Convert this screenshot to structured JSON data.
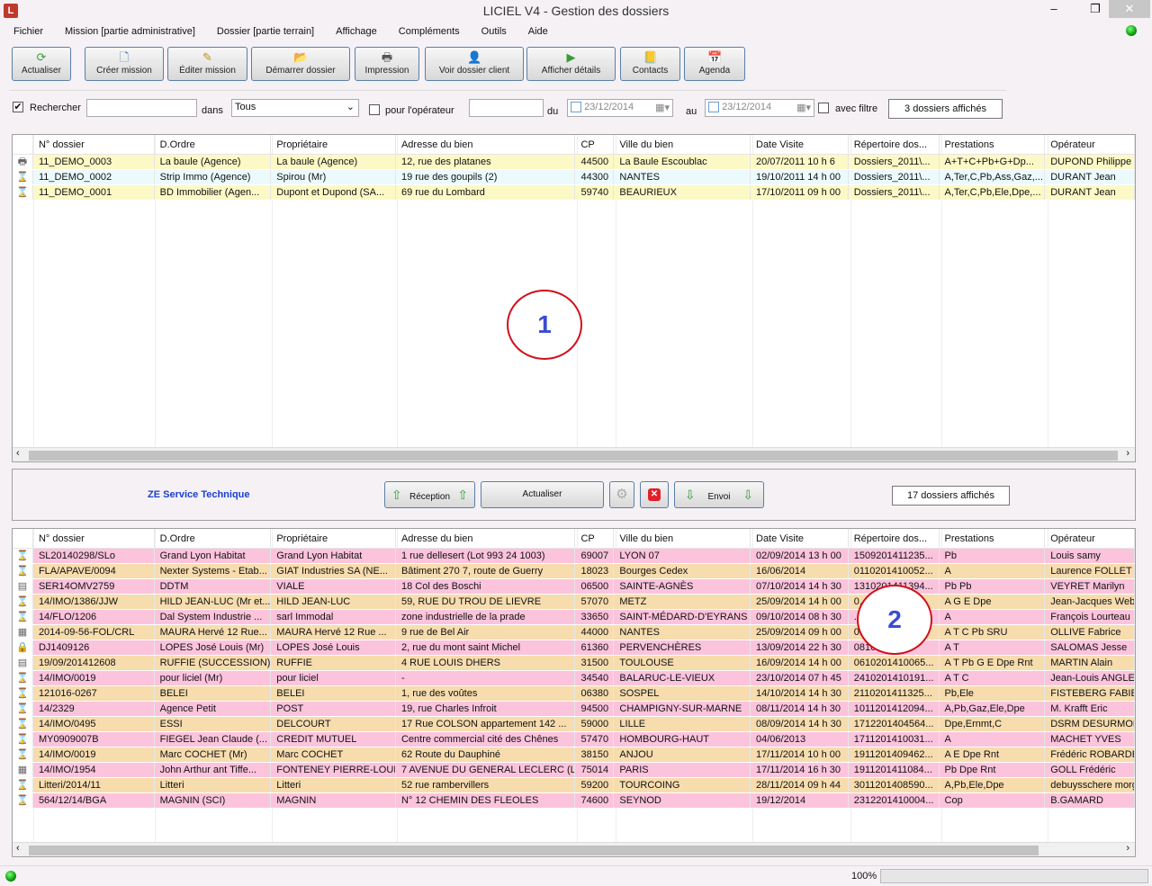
{
  "window": {
    "title": "LICIEL V4 - Gestion des dossiers",
    "app_icon": "L"
  },
  "menu": [
    "Fichier",
    "Mission [partie administrative]",
    "Dossier [partie terrain]",
    "Affichage",
    "Compléments",
    "Outils",
    "Aide"
  ],
  "toolbar": [
    {
      "label": "Actualiser",
      "icon": "refresh-icon",
      "glyph": "⟳",
      "color": "#3aa33a"
    },
    {
      "label": "Créer mission",
      "icon": "new-document-icon",
      "glyph": "🗋",
      "color": "#3a6fb0"
    },
    {
      "label": "Éditer mission",
      "icon": "edit-document-icon",
      "glyph": "✎",
      "color": "#c8901a"
    },
    {
      "label": "Démarrer dossier",
      "icon": "start-folder-icon",
      "glyph": "📂",
      "color": "#d8a020"
    },
    {
      "label": "Impression",
      "icon": "printer-icon",
      "glyph": "🖶",
      "color": "#555"
    },
    {
      "label": "Voir dossier client",
      "icon": "client-folder-icon",
      "glyph": "👤",
      "color": "#d07020"
    },
    {
      "label": "Afficher détails",
      "icon": "details-icon",
      "glyph": "▶",
      "color": "#3a9a3a"
    },
    {
      "label": "Contacts",
      "icon": "contacts-book-icon",
      "glyph": "📒",
      "color": "#6a6a30"
    },
    {
      "label": "Agenda",
      "icon": "calendar-icon",
      "glyph": "📅",
      "color": "#c02020"
    }
  ],
  "filter": {
    "search_checked": true,
    "search_label": "Rechercher",
    "search_value": "",
    "dans_label": "dans",
    "dans_value": "Tous",
    "operator_checked": false,
    "operator_label": "pour l'opérateur",
    "operator_value": "",
    "du_label": "du",
    "date_from": "23/12/2014",
    "au_label": "au",
    "date_to": "23/12/2014",
    "avec_filtre_checked": false,
    "avec_filtre_label": "avec filtre",
    "count": "3 dossiers affichés"
  },
  "columns": [
    "N° dossier",
    "D.Ordre",
    "Propriétaire",
    "Adresse du bien",
    "CP",
    "Ville du bien",
    "Date Visite",
    "Répertoire dos...",
    "Prestations",
    "Opérateur"
  ],
  "top_rows": [
    {
      "icon": "printer-add-icon",
      "cells": [
        "11_DEMO_0003",
        "La baule (Agence)",
        "La baule (Agence)",
        "12, rue des platanes",
        "44500",
        "La Baule Escoublac",
        "20/07/2011 10 h 6",
        "Dossiers_2011\\...",
        "A+T+C+Pb+G+Dp...",
        "DUPOND Philippe"
      ]
    },
    {
      "icon": "hourglass-add-icon",
      "cells": [
        "11_DEMO_0002",
        "Strip Immo (Agence)",
        "Spirou (Mr)",
        "19 rue des goupils (2)",
        "44300",
        "NANTES",
        "19/10/2011 14 h 00",
        "Dossiers_2011\\...",
        "A,Ter,C,Pb,Ass,Gaz,...",
        "DURANT Jean"
      ]
    },
    {
      "icon": "hourglass-add-icon",
      "cells": [
        "11_DEMO_0001",
        "BD Immobilier (Agen...",
        "Dupont et Dupond (SA...",
        "69 rue du Lombard",
        "59740",
        "BEAURIEUX",
        "17/10/2011 09 h 00",
        "Dossiers_2011\\...",
        "A,Ter,C,Pb,Ele,Dpe,...",
        "DURANT Jean"
      ]
    }
  ],
  "annotation1": "1",
  "annotation2": "2",
  "service": {
    "title": "ZE Service Technique",
    "reception": "Réception",
    "actualiser": "Actualiser",
    "envoi": "Envoi",
    "count": "17 dossiers affichés"
  },
  "bottom_rows": [
    {
      "icon": "hourglass-add-icon",
      "cells": [
        "SL20140298/SLo",
        "Grand Lyon Habitat",
        "Grand Lyon Habitat",
        "1 rue dellesert (Lot 993 24 1003)",
        "69007",
        "LYON 07",
        "02/09/2014 13 h 00",
        "1509201411235...",
        "Pb",
        "Louis samy"
      ]
    },
    {
      "icon": "hourglass-icon",
      "cells": [
        "FLA/APAVE/0094",
        "Nexter Systems - Etab...",
        "GIAT Industries SA (NE...",
        "Bâtiment 270 7, route de Guerry",
        "18023",
        "Bourges Cedex",
        "16/06/2014",
        "0110201410052...",
        "A",
        "Laurence FOLLET"
      ]
    },
    {
      "icon": "edit-form-icon",
      "cells": [
        "SER14OMV2759",
        "DDTM",
        "VIALE",
        "18 Col des Boschi",
        "06500",
        "SAINTE-AGNÈS",
        "07/10/2014 14 h 30",
        "1310201411394...",
        "Pb Pb",
        "VEYRET Marilyn"
      ]
    },
    {
      "icon": "hourglass-add-icon",
      "cells": [
        "14/IMO/1386/JJW",
        "HILD JEAN-LUC (Mr et...",
        "HILD JEAN-LUC",
        "59, RUE DU TROU DE LIEVRE",
        "57070",
        "METZ",
        "25/09/2014 14 h 00",
        "0...",
        "A G E Dpe",
        "Jean-Jacques Weber"
      ]
    },
    {
      "icon": "hourglass-icon",
      "cells": [
        "14/FLO/1206",
        "Dal System Industrie ...",
        "sarl Immodal",
        "zone industrielle de la prade",
        "33650",
        "SAINT-MÉDARD-D'EYRANS",
        "09/10/2014 08 h 30",
        "...",
        "A",
        "François Lourteau"
      ]
    },
    {
      "icon": "form-add-icon",
      "cells": [
        "2014-09-56-FOL/CRL",
        "MAURA Hervé 12 Rue...",
        "MAURA Hervé 12 Rue ...",
        "9 rue de Bel Air",
        "44000",
        "NANTES",
        "25/09/2014 09 h 00",
        "0...",
        "A T C Pb SRU",
        "OLLIVE Fabrice"
      ]
    },
    {
      "icon": "lock-icon",
      "cells": [
        "DJ1409126",
        "LOPES José Louis (Mr)",
        "LOPES José Louis",
        "2, rue du mont saint Michel",
        "61360",
        "PERVENCHÈRES",
        "13/09/2014 22 h 30",
        "0810...484...",
        "A T",
        "SALOMAS Jesse"
      ]
    },
    {
      "icon": "edit-form-icon",
      "cells": [
        "19/09/201412608",
        "RUFFIE (SUCCESSION)",
        "RUFFIE",
        "4 RUE LOUIS DHERS",
        "31500",
        "TOULOUSE",
        "16/09/2014 14 h 00",
        "0610201410065...",
        "A T Pb G E Dpe Rnt",
        "MARTIN Alain"
      ]
    },
    {
      "icon": "hourglass-add-icon",
      "cells": [
        "14/IMO/0019",
        "pour liciel (Mr)",
        "pour liciel",
        "-",
        "34540",
        "BALARUC-LE-VIEUX",
        "23/10/2014 07 h 45",
        "2410201410191...",
        "A T C",
        "Jean-Louis ANGLES"
      ]
    },
    {
      "icon": "hourglass-icon",
      "cells": [
        "121016-0267",
        "BELEI",
        "BELEI",
        "1, rue des voûtes",
        "06380",
        "SOSPEL",
        "14/10/2014 14 h 30",
        "2110201411325...",
        "Pb,Ele",
        "FISTEBERG FABIEN"
      ]
    },
    {
      "icon": "hourglass-icon",
      "cells": [
        "14/2329",
        "Agence Petit",
        "POST",
        "19, rue Charles Infroit",
        "94500",
        "CHAMPIGNY-SUR-MARNE",
        "08/11/2014 14 h 30",
        "1011201412094...",
        "A,Pb,Gaz,Ele,Dpe",
        "M. Krafft Eric"
      ]
    },
    {
      "icon": "hourglass-icon",
      "cells": [
        "14/IMO/0495",
        "ESSI",
        "DELCOURT",
        "17 Rue COLSON appartement 142 ...",
        "59000",
        "LILLE",
        "08/09/2014 14 h 30",
        "1712201404564...",
        "Dpe,Ernmt,C",
        "DSRM DESURMONT"
      ]
    },
    {
      "icon": "hourglass-add-icon",
      "cells": [
        "MY0909007B",
        "FIEGEL Jean Claude  (...",
        "CREDIT MUTUEL",
        "Centre commercial cité des Chênes",
        "57470",
        "HOMBOURG-HAUT",
        "04/06/2013",
        "1711201410031...",
        "A",
        "MACHET YVES"
      ]
    },
    {
      "icon": "hourglass-add-icon",
      "cells": [
        "14/IMO/0019",
        "Marc COCHET (Mr)",
        "Marc COCHET",
        "62 Route du Dauphiné",
        "38150",
        "ANJOU",
        "17/11/2014 10 h 00",
        "1911201409462...",
        "A E Dpe Rnt",
        "Frédéric ROBARDET"
      ]
    },
    {
      "icon": "form-add-icon",
      "cells": [
        "14/IMO/1954",
        "John Arthur ant Tiffe...",
        "FONTENEY PIERRE-LOUIS",
        "7 AVENUE DU GENERAL LECLERC (L...",
        "75014",
        "PARIS",
        "17/11/2014 16 h 30",
        "1911201411084...",
        "Pb Dpe Rnt",
        "GOLL Frédéric"
      ]
    },
    {
      "icon": "hourglass-icon",
      "cells": [
        "Litteri/2014/11",
        "Litteri",
        "Litteri",
        "52 rue rambervillers",
        "59200",
        "TOURCOING",
        "28/11/2014 09 h 44",
        "3011201408590...",
        "A,Pb,Ele,Dpe",
        "debuysschere morgan"
      ]
    },
    {
      "icon": "hourglass-add-icon",
      "cells": [
        "564/12/14/BGA",
        "MAGNIN (SCI)",
        "MAGNIN",
        "N° 12 CHEMIN DES FLEOLES",
        "74600",
        "SEYNOD",
        "19/12/2014",
        "2312201410004...",
        "Cop",
        "B.GAMARD"
      ]
    }
  ],
  "colors": {
    "top_row_yellow": "#fdf9c6",
    "top_row_cyan": "#ecfafe",
    "bottom_row_pink": "#fcc3dc",
    "bottom_row_tan": "#f7dcae",
    "service_title": "#1a3fd0"
  },
  "status": {
    "zoom": "100%"
  }
}
